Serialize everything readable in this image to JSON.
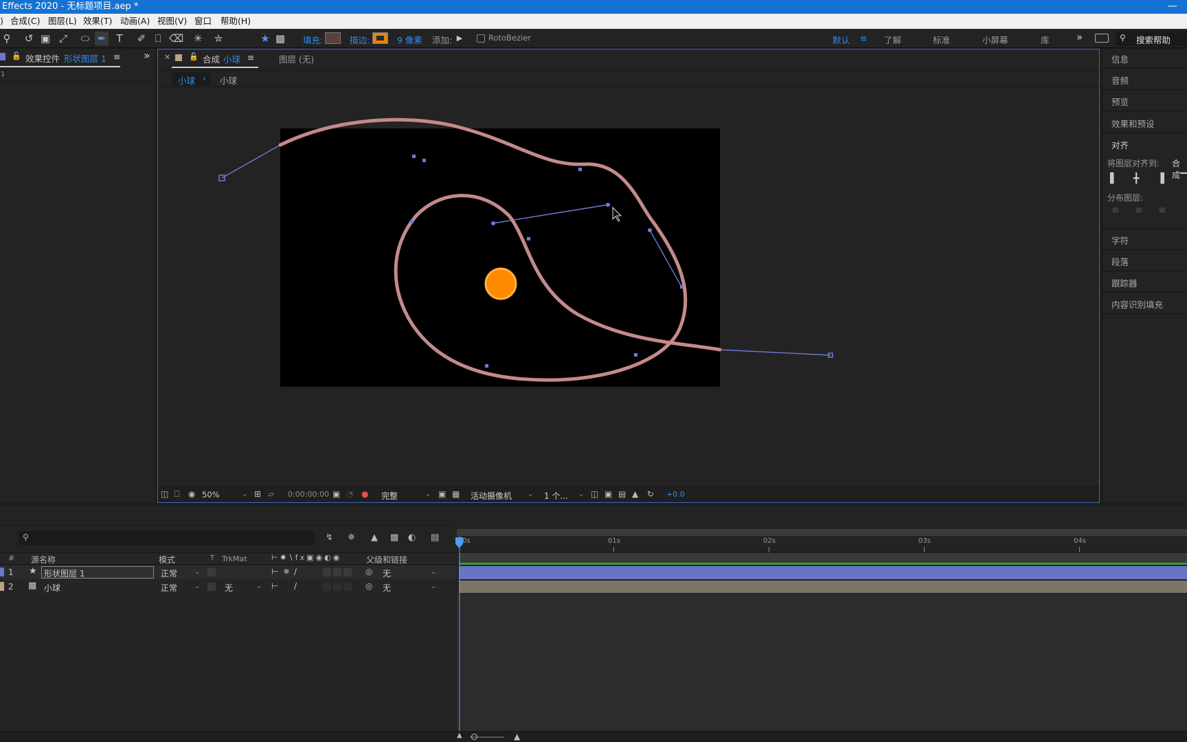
{
  "window": {
    "title": "Effects 2020 - 无标题项目.aep *",
    "minimize": "—"
  },
  "menu": [
    "合成(C)",
    "图层(L)",
    "效果(T)",
    "动画(A)",
    "视图(V)",
    "窗口",
    "帮助(H)"
  ],
  "toolbar": {
    "fill_label": "填充:",
    "stroke_label": "描边:",
    "stroke_width": "9 像素",
    "add_label": "添加:",
    "rotobezier": "RotoBezier",
    "workspaces": [
      "默认",
      "了解",
      "标准",
      "小屏幕",
      "库"
    ],
    "overflow": "»",
    "search_help": "搜索帮助"
  },
  "colors": {
    "accent": "#2d8ceb",
    "fill_swatch": "#5a3f3f",
    "stroke_swatch": "#f08a1c",
    "orange_ball": "#ff8c00",
    "path": "#b07878",
    "handle": "#6f7ad8",
    "bar_blue": "#6a74c7",
    "bar_tan": "#7d7467",
    "title_blue": "#1572d3"
  },
  "left_panel": {
    "tab_prefix": "效果控件",
    "tab_layer": "形状图层 1",
    "menu_icon": "≡",
    "overflow": "»",
    "row": "1"
  },
  "comp_panel": {
    "close": "×",
    "tab_prefix": "合成",
    "tab_name": "小球",
    "tab_menu": "≡",
    "layer_tab": "图层 (无)",
    "breadcrumb_active": "小球",
    "breadcrumb_arrow": "‹",
    "breadcrumb_next": "小球",
    "zoom": "50%",
    "timecode": "0:00:00:00",
    "resolution": "完整",
    "camera": "活动摄像机",
    "views": "1 个...",
    "exposure": "+0.0"
  },
  "right_panel": {
    "items": [
      "信息",
      "音频",
      "预览",
      "效果和预设",
      "对齐"
    ],
    "align_to_label": "将图层对齐到:",
    "align_to_value": "合成",
    "distribute_label": "分布图层:",
    "items2": [
      "字符",
      "段落",
      "跟踪器",
      "内容识别填充"
    ]
  },
  "timeline": {
    "search_placeholder": "",
    "columns": {
      "num": "#",
      "source": "源名称",
      "mode": "模式",
      "t": "T",
      "trkmat": "TrkMat",
      "parent": "父级和链接"
    },
    "layers": [
      {
        "num": "1",
        "name": "形状图层 1",
        "mode": "正常",
        "trkmat": "",
        "parent": "无"
      },
      {
        "num": "2",
        "name": "小球",
        "mode": "正常",
        "trkmat": "无",
        "parent": "无"
      }
    ],
    "ruler": [
      "0s",
      "01s",
      "02s",
      "03s",
      "04s"
    ]
  }
}
